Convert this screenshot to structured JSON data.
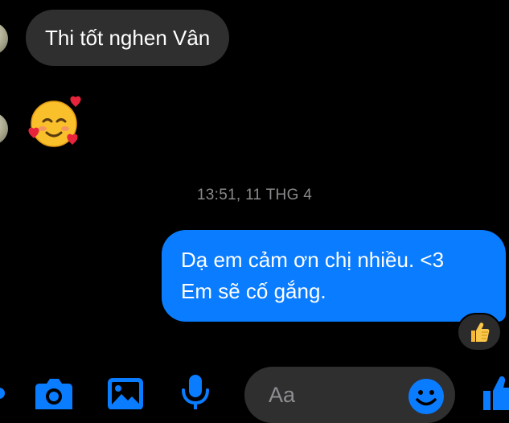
{
  "conversation": {
    "incoming_message": "Thi tốt nghen Vân",
    "timestamp": "13:51, 11 THG 4",
    "outgoing_lines": [
      "Dạ em cảm ơn chị nhiều. <3",
      "Em sẽ cố gắng."
    ]
  },
  "composer": {
    "placeholder": "Aa"
  },
  "icons": {
    "emoji_message": "smiling-face-with-hearts-icon",
    "reaction": "thumbs-up-icon",
    "camera": "camera-icon",
    "gallery": "image-icon",
    "microphone": "microphone-icon",
    "emoji_picker": "smiley-icon",
    "like": "like-icon"
  },
  "colors": {
    "accent": "#0a7cff",
    "incoming_bubble": "#2f2f2f",
    "background": "#000000",
    "timestamp": "#8a8a8e"
  }
}
